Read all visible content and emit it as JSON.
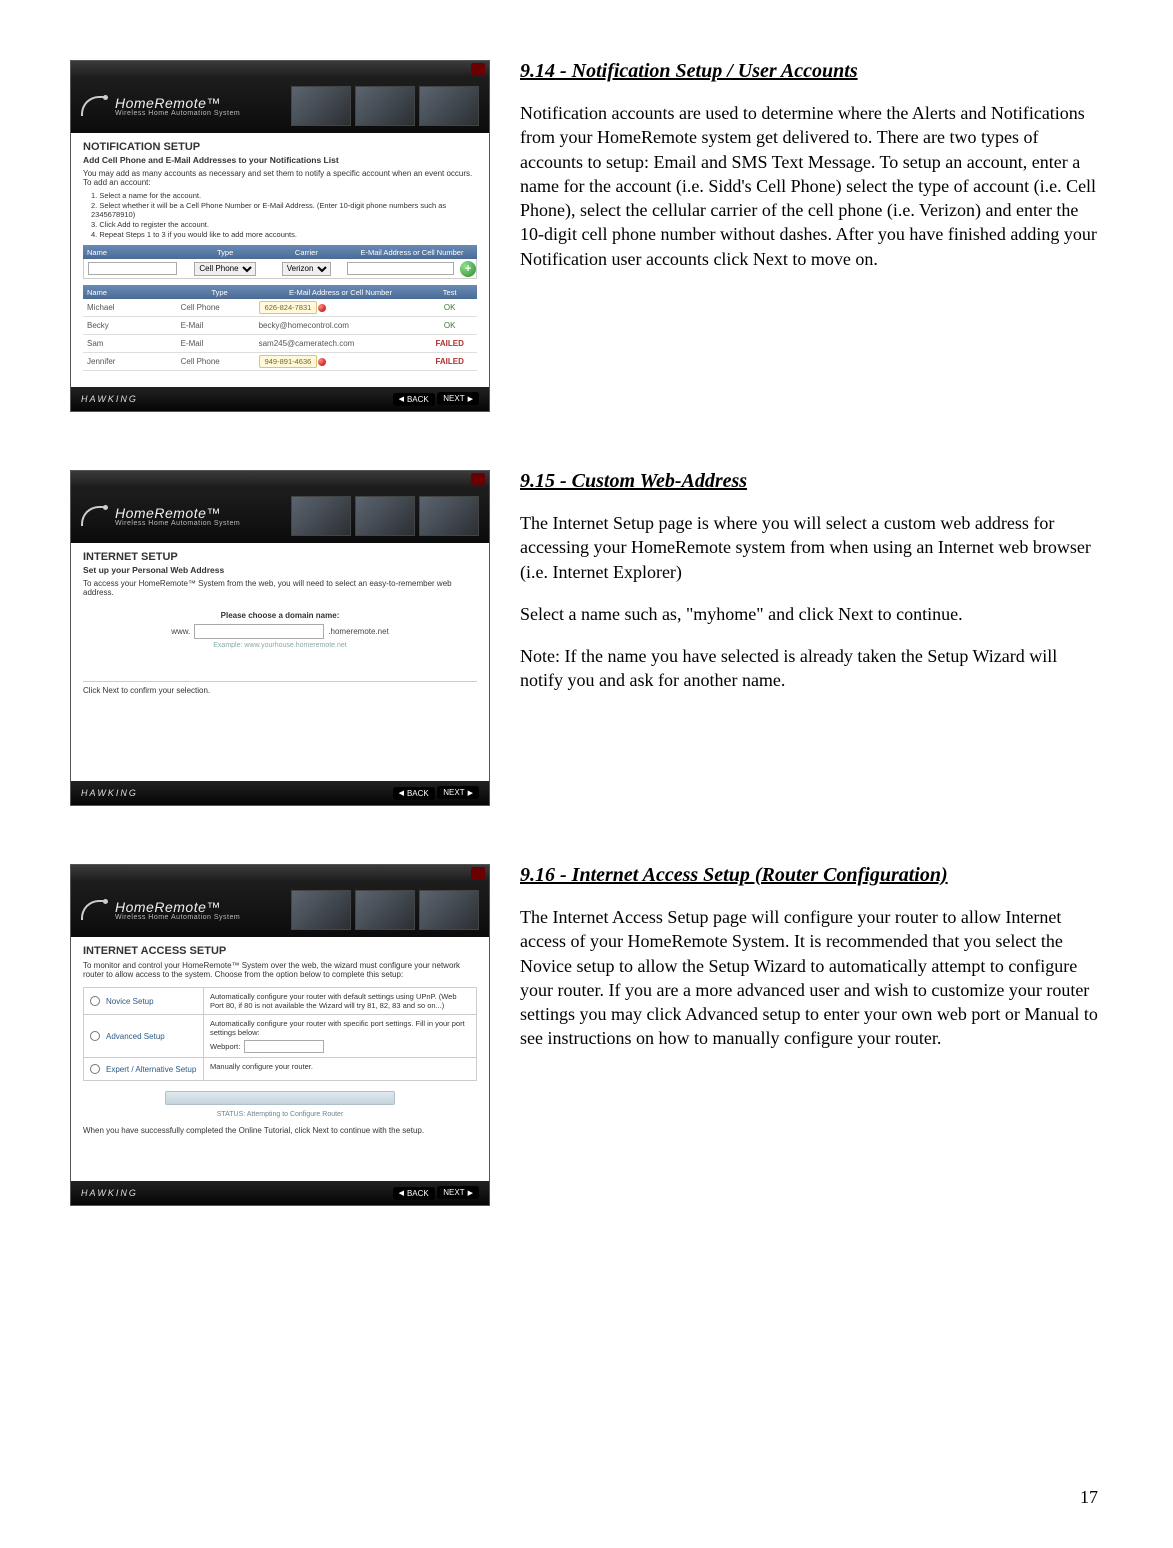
{
  "page_number": "17",
  "brand_name": "HomeRemote™",
  "brand_sub": "Wireless Home Automation System",
  "footer_brand": "HAWKING",
  "footer_back": "BACK",
  "footer_next": "NEXT",
  "section914": {
    "title": "9.14 - Notification Setup / User Accounts",
    "body": "Notification accounts are used to determine where the Alerts and Notifications from your HomeRemote system get delivered to.  There are two types of accounts to setup: Email and SMS Text Message.  To setup an account, enter a name for the account (i.e. Sidd's Cell Phone) select the type of account (i.e. Cell Phone), select the cellular carrier of the cell phone (i.e. Verizon) and enter the 10-digit cell phone number without dashes.  After you have finished adding your Notification user accounts click Next to move on."
  },
  "section915": {
    "title": "9.15 - Custom Web-Address",
    "p1": "The Internet Setup page is where you will select a custom web address for accessing your HomeRemote system from when using an Internet web browser (i.e. Internet Explorer)",
    "p2": "Select a name such as, \"myhome\" and click Next to continue.",
    "p3": "Note: If the name you have selected is already taken the Setup Wizard will notify you and ask for another name."
  },
  "section916": {
    "title": "9.16 - Internet Access Setup (Router Configuration)",
    "body": "The Internet Access Setup page will configure your router to allow Internet access of your HomeRemote System.  It is recommended that you select the Novice setup to allow the Setup Wizard to automatically attempt to configure your router.  If you are a more advanced user and wish to customize your router settings you may click Advanced setup to enter your own web port or Manual to see instructions on how to manually configure your router."
  },
  "shot_notification": {
    "heading": "NOTIFICATION SETUP",
    "subheading": "Add Cell Phone and E-Mail Addresses to your Notifications List",
    "intro": "You may add as many accounts as necessary and set them to notify a specific account when an event occurs. To add an account:",
    "step1": "1. Select a name for the account.",
    "step2": "2. Select whether it will be a Cell Phone Number or E-Mail Address. (Enter 10-digit phone numbers such as 2345678910)",
    "step3": "3. Click Add to register the account.",
    "step4": "4. Repeat Steps 1 to 3 if you would like to add more accounts.",
    "hdr_name": "Name",
    "hdr_type": "Type",
    "hdr_carrier": "Carrier",
    "hdr_addr": "E-Mail Address or Cell Number",
    "sel_type": "Cell Phone",
    "sel_carrier": "Verizon",
    "list_hdr_name": "Name",
    "list_hdr_type": "Type",
    "list_hdr_addr": "E-Mail Address or Cell Number",
    "list_hdr_test": "Test",
    "rows": [
      {
        "name": "Michael",
        "type": "Cell Phone",
        "addr": "626-824-7831",
        "status": "OK",
        "chip": true
      },
      {
        "name": "Becky",
        "type": "E-Mail",
        "addr": "becky@homecontrol.com",
        "status": "OK",
        "chip": false
      },
      {
        "name": "Sam",
        "type": "E-Mail",
        "addr": "sam245@cameratech.com",
        "status": "FAILED",
        "chip": false
      },
      {
        "name": "Jennifer",
        "type": "Cell Phone",
        "addr": "949-891-4636",
        "status": "FAILED",
        "chip": true
      }
    ]
  },
  "shot_internet": {
    "heading": "INTERNET SETUP",
    "subheading": "Set up your Personal Web Address",
    "intro": "To access your HomeRemote™ System from the web, you will need to select an easy-to-remember web address.",
    "choose_label": "Please choose a domain name:",
    "www": "www.",
    "suffix": ".homeremote.net",
    "example": "Example: www.yourhouse.homeremote.net",
    "confirm": "Click Next to confirm your selection."
  },
  "shot_access": {
    "heading": "INTERNET ACCESS SETUP",
    "intro": "To monitor and control your HomeRemote™ System over the web, the wizard must configure your network router to allow access to the system. Choose from the option below to complete this setup:",
    "opt_novice": "Novice Setup",
    "opt_novice_desc": "Automatically configure your router with default settings using UPnP. (Web Port 80, if 80 is not available the Wizard will try 81, 82, 83 and so on...)",
    "opt_adv": "Advanced Setup",
    "opt_adv_desc": "Automatically configure your router with specific port settings. Fill in your port settings below:",
    "webport_label": "Webport:",
    "opt_expert": "Expert / Alternative Setup",
    "opt_expert_desc": "Manually configure your router.",
    "status_label": "STATUS: Attempting to Configure Router",
    "tutorial": "When you have successfully completed the Online Tutorial, click Next to continue with the setup."
  }
}
